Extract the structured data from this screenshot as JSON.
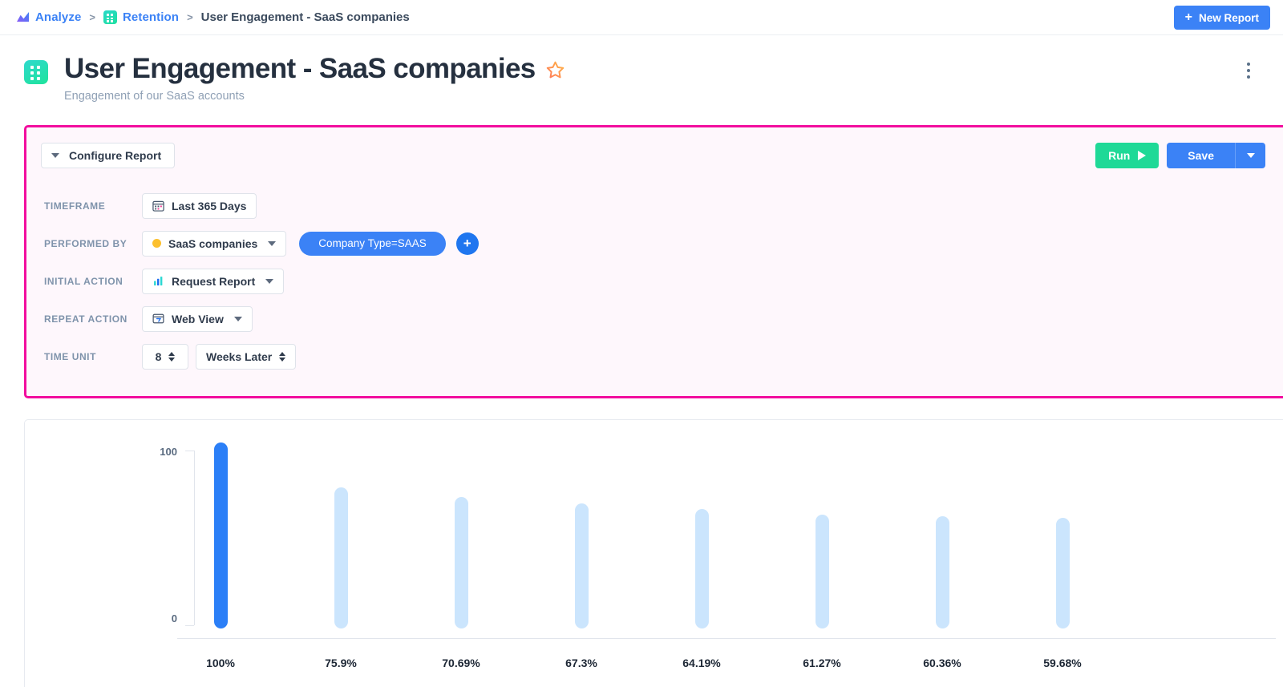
{
  "breadcrumb": {
    "analyze": "Analyze",
    "retention": "Retention",
    "current": "User Engagement - SaaS companies",
    "separator": ">"
  },
  "header": {
    "new_report_label": "New Report",
    "new_report_color": "#3b82f6",
    "plus": "+"
  },
  "title": {
    "text": "User Engagement - SaaS companies",
    "subtitle": "Engagement of our SaaS accounts",
    "icon": "retention-grid-icon",
    "star": "favorite-star-icon",
    "kebab": "more-options-icon"
  },
  "config": {
    "highlight_color": "#f20d9e",
    "background": "#fef7fc",
    "configure_label": "Configure Report",
    "run_label": "Run",
    "run_color": "#1fd997",
    "save_label": "Save",
    "save_color": "#3b82f6",
    "rows": {
      "timeframe": {
        "label": "TIMEFRAME",
        "value": "Last 365 Days",
        "icon": "calendar-icon"
      },
      "performed_by": {
        "label": "PERFORMED BY",
        "value": "SaaS companies",
        "dot_color": "#fcc02e",
        "filter_pill": "Company Type=SAAS",
        "add_label": "+"
      },
      "initial_action": {
        "label": "INITIAL ACTION",
        "value": "Request Report",
        "icon": "bar-chart-icon"
      },
      "repeat_action": {
        "label": "REPEAT ACTION",
        "value": "Web View",
        "icon": "web-view-icon"
      },
      "time_unit": {
        "label": "TIME UNIT",
        "count": "8",
        "unit": "Weeks Later"
      }
    }
  },
  "chart_data": {
    "type": "bar",
    "title": "",
    "xlabel": "",
    "ylabel": "",
    "ylim": [
      0,
      100
    ],
    "y_ticks": [
      "100",
      "0"
    ],
    "grid": false,
    "legend": null,
    "categories": [
      "100%",
      "75.9%",
      "70.69%",
      "67.3%",
      "64.19%",
      "61.27%",
      "60.36%",
      "59.68%"
    ],
    "values": [
      100,
      75.9,
      70.69,
      67.3,
      64.19,
      61.27,
      60.36,
      59.68
    ],
    "bar_colors": [
      "#2b7ff7",
      "#cbe5fd",
      "#cbe5fd",
      "#cbe5fd",
      "#cbe5fd",
      "#cbe5fd",
      "#cbe5fd",
      "#cbe5fd"
    ]
  }
}
